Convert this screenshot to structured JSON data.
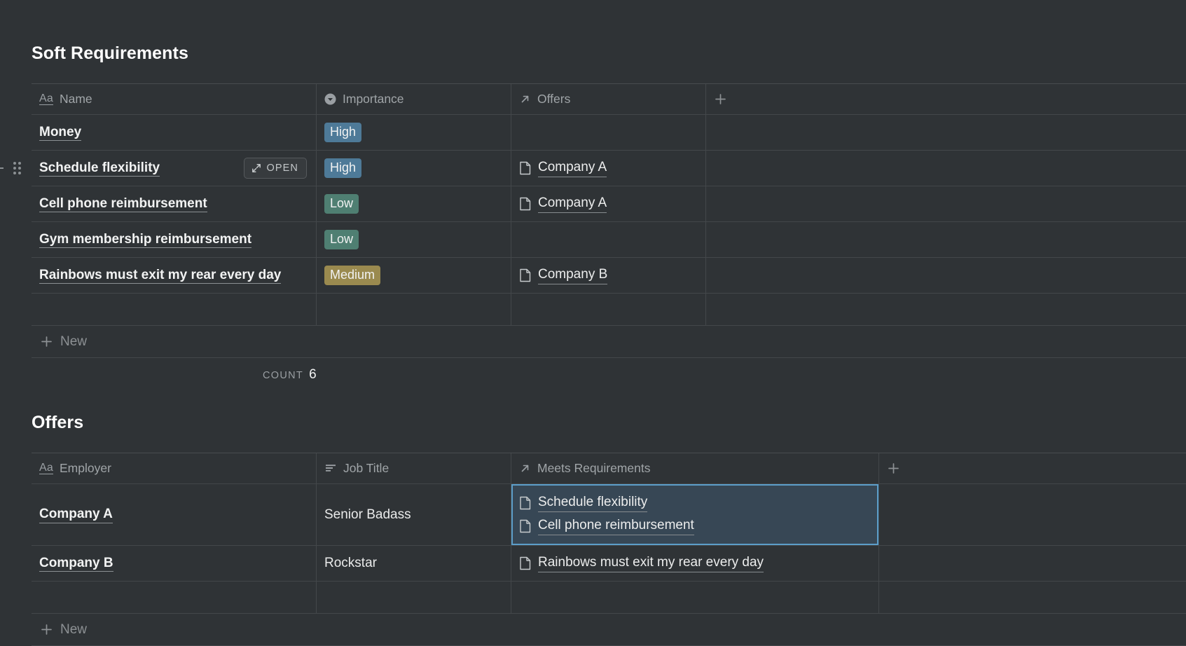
{
  "soft_requirements": {
    "title": "Soft Requirements",
    "columns": [
      {
        "label": "Name",
        "icon": "text-aa-icon"
      },
      {
        "label": "Importance",
        "icon": "select-dropdown-icon"
      },
      {
        "label": "Offers",
        "icon": "relation-arrow-icon"
      },
      {
        "label": "",
        "icon": "plus-icon"
      }
    ],
    "rows": [
      {
        "name": "Money",
        "importance": "High",
        "importance_color": "#4e7a98",
        "offers": []
      },
      {
        "name": "Schedule flexibility",
        "importance": "High",
        "importance_color": "#4e7a98",
        "offers": [
          "Company A"
        ],
        "hovered": true,
        "open_label": "OPEN"
      },
      {
        "name": "Cell phone reimbursement",
        "importance": "Low",
        "importance_color": "#4f7f72",
        "offers": [
          "Company A"
        ]
      },
      {
        "name": "Gym membership reimbursement",
        "importance": "Low",
        "importance_color": "#4f7f72",
        "offers": []
      },
      {
        "name": "Rainbows must exit my rear every day",
        "importance": "Medium",
        "importance_color": "#9a8a4f",
        "offers": [
          "Company B"
        ]
      }
    ],
    "new_row_label": "New",
    "count_label": "Count",
    "count_value": "6"
  },
  "offers": {
    "title": "Offers",
    "columns": [
      {
        "label": "Employer",
        "icon": "text-aa-icon"
      },
      {
        "label": "Job Title",
        "icon": "rich-text-lines-icon"
      },
      {
        "label": "Meets Requirements",
        "icon": "relation-arrow-icon"
      },
      {
        "label": "",
        "icon": "plus-icon"
      }
    ],
    "rows": [
      {
        "employer": "Company A",
        "job_title": "Senior Badass",
        "meets_requirements": [
          "Schedule flexibility",
          "Cell phone reimbursement"
        ],
        "selected": true
      },
      {
        "employer": "Company B",
        "job_title": "Rockstar",
        "meets_requirements": [
          "Rainbows must exit my rear every day"
        ],
        "selected": false
      }
    ],
    "new_row_label": "New"
  },
  "theme": {
    "background": "#2f3336",
    "border": "#43474a",
    "selection_border": "#5c9ec9",
    "selection_fill": "#374755",
    "muted_text": "#9a9fa3"
  }
}
